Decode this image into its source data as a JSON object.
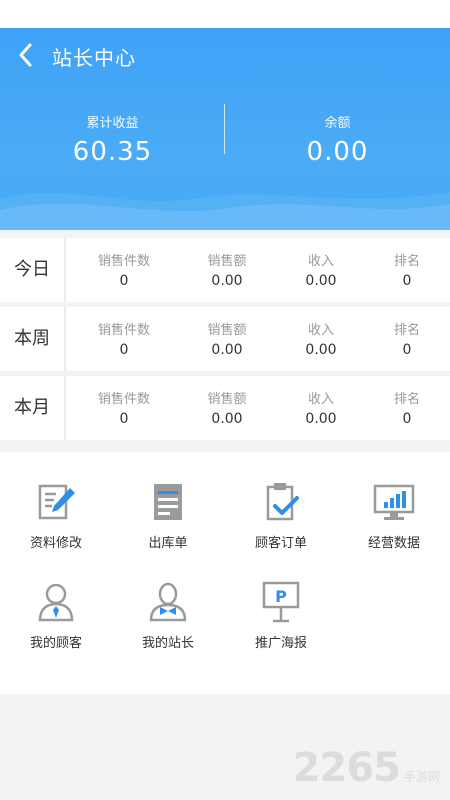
{
  "header": {
    "title": "站长中心",
    "total_income_label": "累计收益",
    "total_income_value": "60.35",
    "balance_label": "余额",
    "balance_value": "0.00"
  },
  "periods": [
    {
      "label": "今日",
      "cells": [
        {
          "head": "销售件数",
          "value": "0"
        },
        {
          "head": "销售额",
          "value": "0.00"
        },
        {
          "head": "收入",
          "value": "0.00"
        },
        {
          "head": "排名",
          "value": "0"
        }
      ]
    },
    {
      "label": "本周",
      "cells": [
        {
          "head": "销售件数",
          "value": "0"
        },
        {
          "head": "销售额",
          "value": "0.00"
        },
        {
          "head": "收入",
          "value": "0.00"
        },
        {
          "head": "排名",
          "value": "0"
        }
      ]
    },
    {
      "label": "本月",
      "cells": [
        {
          "head": "销售件数",
          "value": "0"
        },
        {
          "head": "销售额",
          "value": "0.00"
        },
        {
          "head": "收入",
          "value": "0.00"
        },
        {
          "head": "排名",
          "value": "0"
        }
      ]
    }
  ],
  "actions": [
    {
      "label": "资料修改",
      "icon": "edit-document-icon"
    },
    {
      "label": "出库单",
      "icon": "outbound-list-icon"
    },
    {
      "label": "顾客订单",
      "icon": "clipboard-check-icon"
    },
    {
      "label": "经营数据",
      "icon": "bar-chart-monitor-icon"
    },
    {
      "label": "我的顾客",
      "icon": "customer-person-icon"
    },
    {
      "label": "我的站长",
      "icon": "manager-person-icon"
    },
    {
      "label": "推广海报",
      "icon": "poster-p-icon"
    }
  ],
  "watermark": {
    "number": "2265",
    "site": "手游网"
  },
  "colors": {
    "header_blue": "#3fa2f7",
    "icon_gray": "#9a9a9a",
    "icon_blue": "#2f8fe8"
  }
}
